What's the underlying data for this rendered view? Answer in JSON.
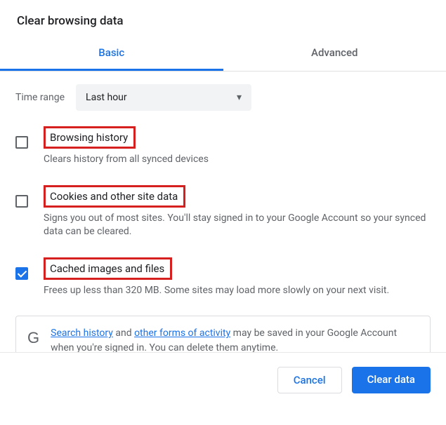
{
  "title": "Clear browsing data",
  "tabs": {
    "basic": "Basic",
    "advanced": "Advanced"
  },
  "timerange": {
    "label": "Time range",
    "value": "Last hour"
  },
  "options": [
    {
      "title": "Browsing history",
      "desc": "Clears history from all synced devices",
      "checked": false
    },
    {
      "title": "Cookies and other site data",
      "desc": "Signs you out of most sites. You'll stay signed in to your Google Account so your synced data can be cleared.",
      "checked": false
    },
    {
      "title": "Cached images and files",
      "desc": "Frees up less than 320 MB. Some sites may load more slowly on your next visit.",
      "checked": true
    }
  ],
  "info": {
    "link1": "Search history",
    "middle1": " and ",
    "link2": "other forms of activity",
    "rest": " may be saved in your Google Account when you're signed in. You can delete them anytime."
  },
  "buttons": {
    "cancel": "Cancel",
    "clear": "Clear data"
  }
}
